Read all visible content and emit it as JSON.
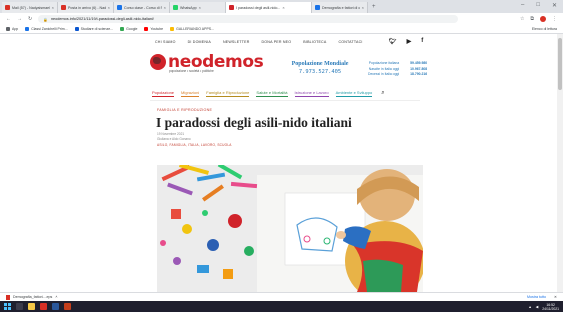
{
  "browser": {
    "tabs": [
      {
        "label": "Mail (57) - Nadyaismaelfa...",
        "color": "#d93025",
        "active": false
      },
      {
        "label": "Posta in arrivo (6) - Nad...",
        "color": "#d93025",
        "active": false
      },
      {
        "label": "Corso clase - Corso di Studi...",
        "color": "#1a73e8",
        "active": false
      },
      {
        "label": "WhatsApp",
        "color": "#25d366",
        "active": false
      },
      {
        "label": "I paradossi degli asili-nido...",
        "color": "#d0232a",
        "active": true
      },
      {
        "label": "Demografia e fattori di crescit...",
        "color": "#1a73e8",
        "active": false
      }
    ],
    "url": "neodemos.info/2021/11/19/i-paradossi-degli-asili-nido-italiani/",
    "bookmarks": [
      {
        "label": "App",
        "color": "#5f6368"
      },
      {
        "label": "Classi Zanichelli Prim...",
        "color": "#1a73e8"
      },
      {
        "label": "Studiare di scienze...",
        "color": "#0b57d0"
      },
      {
        "label": "Google",
        "color": "#34a853"
      },
      {
        "label": "Youtube",
        "color": "#ff0000"
      },
      {
        "label": "GALLERIANDO APPS...",
        "color": "#fbbc04"
      }
    ],
    "bookmarks_other": "Elenco di lettura",
    "download_file": "Demografia_fattori....eps",
    "download_show_all": "Mostra tutto"
  },
  "site": {
    "menu": [
      "CHI SIAMO",
      "DI DOMENIA",
      "NEWSLETTER",
      "DONA PER NEO",
      "BIBLIOTECA",
      "CONTATTACI"
    ],
    "social": [
      "twitter-icon",
      "youtube-icon",
      "facebook-icon"
    ],
    "logo_name": "neodemos",
    "logo_tag": "popolazione • società • politiche",
    "population_title": "Popolazione Mondiale",
    "population_value": "7.973.527.405",
    "stats": [
      {
        "label": "Popolazione italiana",
        "value": "59.459.980"
      },
      {
        "label": "Nascite in Italia oggi",
        "value": "10.967.808"
      },
      {
        "label": "Decessi in Italia oggi",
        "value": "18.790.216"
      }
    ],
    "categories": [
      {
        "label": "Popolazione",
        "color": "#d0232a"
      },
      {
        "label": "Migrazioni",
        "color": "#d9822b"
      },
      {
        "label": "Famiglia e Riproduzione",
        "color": "#b58c1e"
      },
      {
        "label": "Salute e Mortalità",
        "color": "#2f8f4e"
      },
      {
        "label": "Istruzione e Lavoro",
        "color": "#8e44ad"
      },
      {
        "label": "Ambiente e Sviluppo",
        "color": "#1f9ba6"
      }
    ],
    "accent": "#d0232a"
  },
  "article": {
    "kicker": "FAMIGLIA E RIPRODUZIONE",
    "title": "I paradossi degli asili-nido italiani",
    "date": "19 Novembre 2021",
    "author": "Giuliana e Aldo Gonano",
    "tags": "ASILO, FAMIGLIA, ITALIA, LAVORO, SCUOLA",
    "image_alt": "child-drawing-with-crayons-photo"
  },
  "taskbar": {
    "time": "16:52",
    "date": "24/11/2021"
  }
}
